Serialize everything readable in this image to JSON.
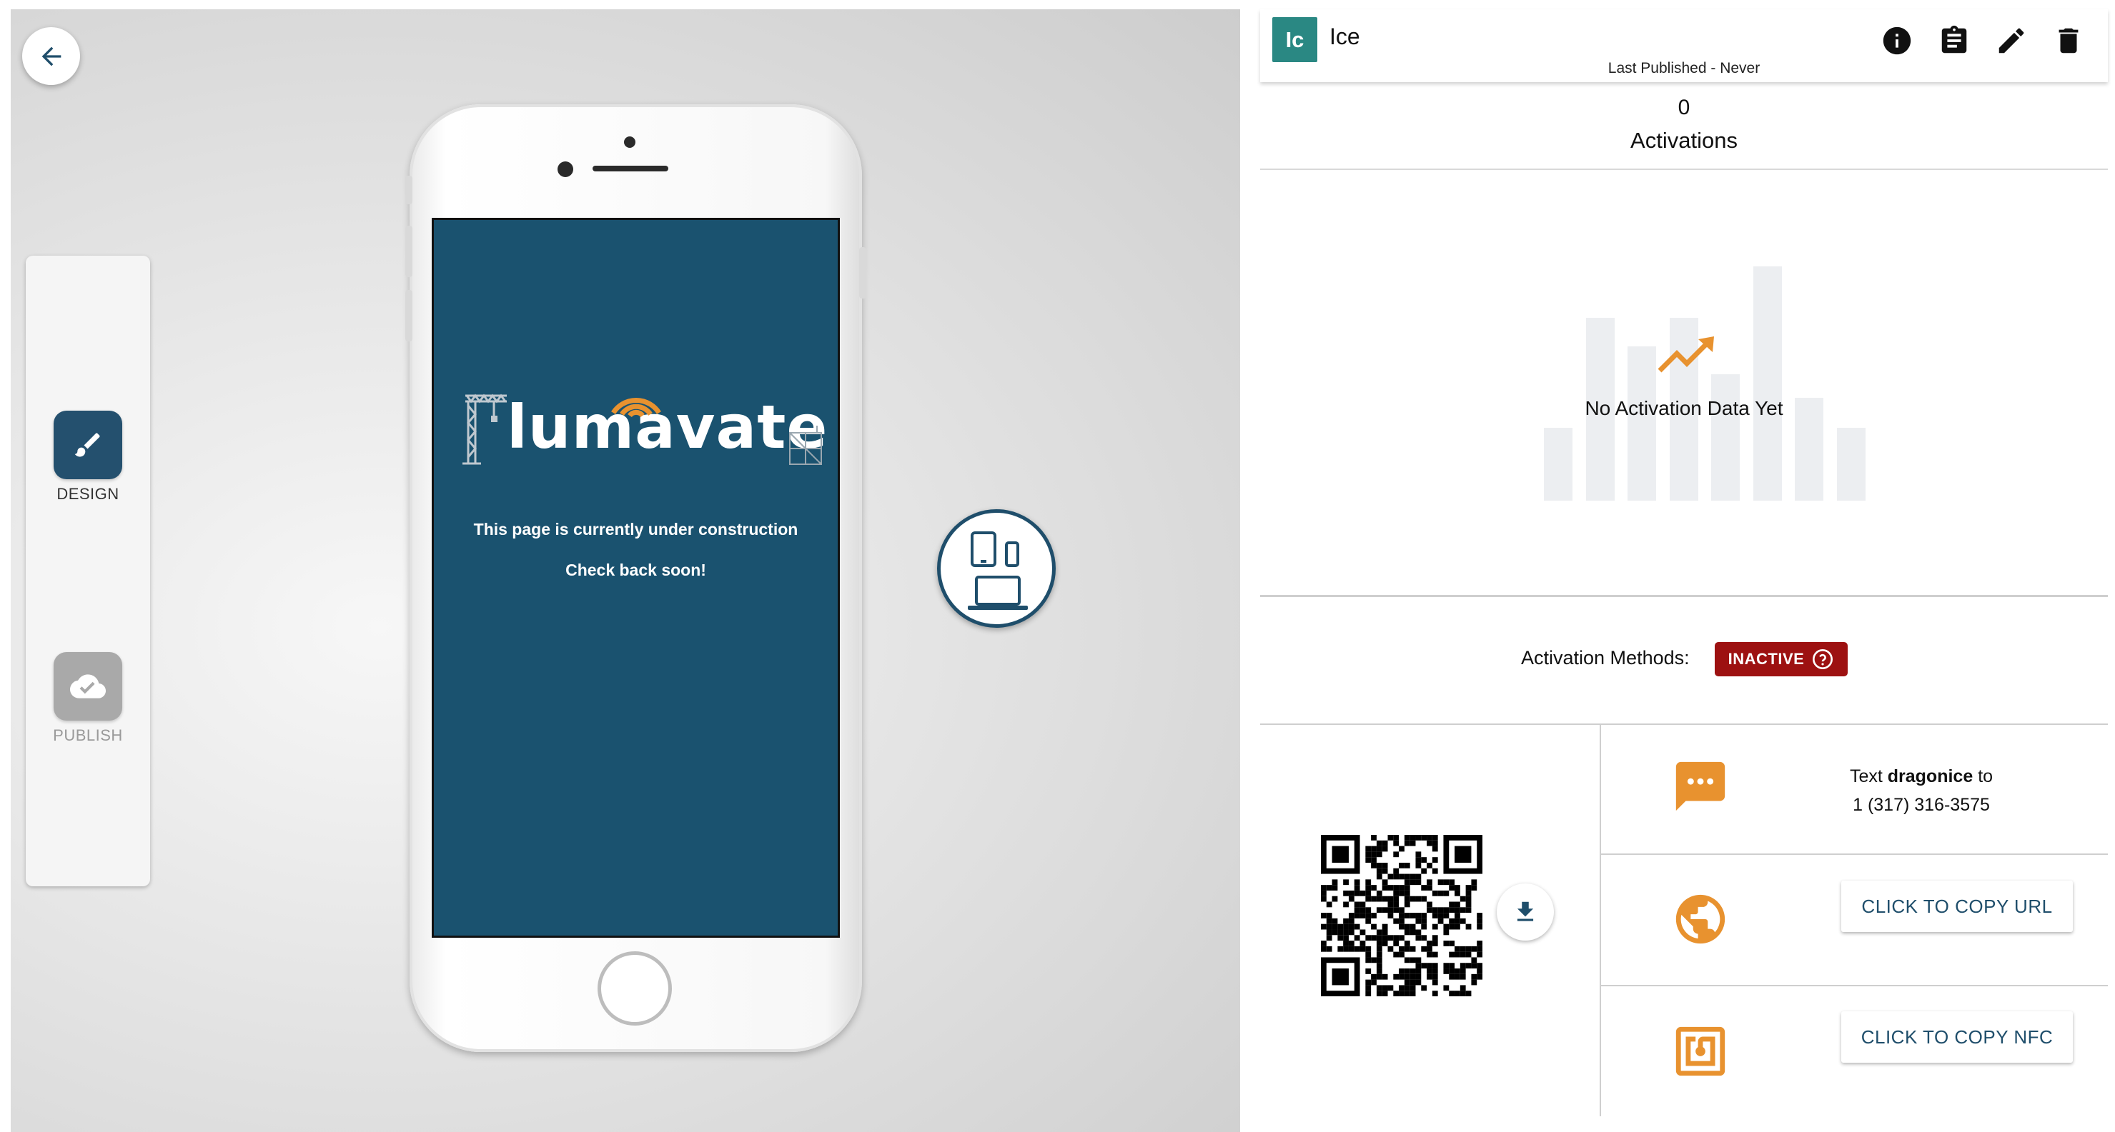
{
  "colors": {
    "brand_dark": "#1f4e6b",
    "accent_orange": "#e8922f",
    "avatar_teal": "#2a8883",
    "inactive_red": "#9d1111",
    "phone_screen": "#1a526f"
  },
  "nav": {
    "back_icon": "arrow-left-icon"
  },
  "toolbar": {
    "design_label": "DESIGN",
    "design_icon": "paintbrush-icon",
    "publish_label": "PUBLISH",
    "publish_icon": "cloud-check-icon"
  },
  "preview": {
    "logo_text": "lumavate",
    "line1": "This page is currently under construction",
    "line2": "Check back soon!",
    "device_toggle_icon": "devices-icon"
  },
  "header": {
    "avatar_initials": "Ic",
    "app_name": "Ice",
    "last_published": "Last Published - Never",
    "actions": [
      "info-icon",
      "clipboard-icon",
      "pencil-icon",
      "trash-icon"
    ]
  },
  "stats": {
    "activation_count": "0",
    "activation_label": "Activations",
    "no_data_text": "No Activation Data Yet",
    "placeholder_bar_levels": [
      0.31,
      0.78,
      0.66,
      0.78,
      0.54,
      1.0,
      0.44,
      0.31
    ]
  },
  "activation": {
    "label": "Activation Methods:",
    "status": "INACTIVE",
    "status_icon": "help-circle-icon",
    "download_icon": "download-icon",
    "sms": {
      "icon": "chat-icon",
      "prefix": "Text",
      "keyword": "dragonice",
      "suffix": "to",
      "phone": "1 (317) 316-3575"
    },
    "url": {
      "icon": "globe-icon",
      "button": "CLICK TO COPY URL"
    },
    "nfc": {
      "icon": "nfc-icon",
      "button": "CLICK TO COPY NFC"
    }
  }
}
